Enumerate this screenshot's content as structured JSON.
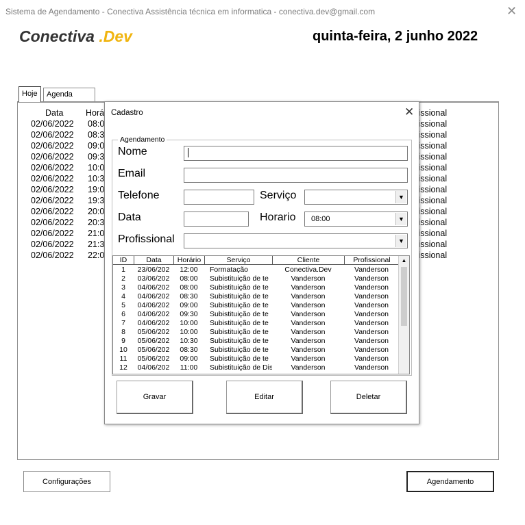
{
  "window": {
    "title": "Sistema de Agendamento - Conectiva Assistência técnica em informatica - conectiva.dev@gmail.com",
    "close_glyph": "✕"
  },
  "logo": {
    "part1": "Conectiva",
    "part2": " .Dev"
  },
  "date_heading": "quinta-feira, 2 junho 2022",
  "tabs": [
    {
      "label": "Hoje"
    },
    {
      "label": "Agenda"
    }
  ],
  "background_list": {
    "headers": {
      "data": "Data",
      "time": "Horá",
      "prof": "ofissional"
    },
    "rows": [
      {
        "date": "02/06/2022",
        "time": "08:0",
        "prof": "ofissional"
      },
      {
        "date": "02/06/2022",
        "time": "08:3",
        "prof": "ofissional"
      },
      {
        "date": "02/06/2022",
        "time": "09:0",
        "prof": "ofissional"
      },
      {
        "date": "02/06/2022",
        "time": "09:3",
        "prof": "ofissional"
      },
      {
        "date": "02/06/2022",
        "time": "10:0",
        "prof": "ofissional"
      },
      {
        "date": "02/06/2022",
        "time": "10:3",
        "prof": "ofissional"
      },
      {
        "date": "02/06/2022",
        "time": "19:0",
        "prof": "ofissional"
      },
      {
        "date": "02/06/2022",
        "time": "19:3",
        "prof": "ofissional"
      },
      {
        "date": "02/06/2022",
        "time": "20:0",
        "prof": "ofissional"
      },
      {
        "date": "02/06/2022",
        "time": "20:3",
        "prof": "ofissional"
      },
      {
        "date": "02/06/2022",
        "time": "21:0",
        "prof": "ofissional"
      },
      {
        "date": "02/06/2022",
        "time": "21:3",
        "prof": "ofissional"
      },
      {
        "date": "02/06/2022",
        "time": "22:0",
        "prof": "ofissional"
      }
    ]
  },
  "main_buttons": {
    "config": "Configurações",
    "agendamento": "Agendamento"
  },
  "dialog": {
    "title": "Cadastro",
    "close_glyph": "✕",
    "frame_label": "Agendamento",
    "labels": {
      "nome": "Nome",
      "email": "Email",
      "telefone": "Telefone",
      "servico": "Serviço",
      "data": "Data",
      "horario": "Horario",
      "profissional": "Profissional"
    },
    "fields": {
      "nome": "",
      "email": "",
      "telefone": "",
      "servico": "",
      "data": "",
      "horario": "08:00",
      "profissional": ""
    },
    "dropdown_glyph": "▼",
    "grid": {
      "headers": [
        "ID",
        "Data",
        "Horário",
        "Serviço",
        "Cliente",
        "Profissional"
      ],
      "rows": [
        [
          "1",
          "23/06/202",
          "12:00",
          "Formatação",
          "Conectiva.Dev",
          "Vanderson"
        ],
        [
          "2",
          "03/06/202",
          "08:00",
          "Subistituição de te",
          "Vanderson",
          "Vanderson"
        ],
        [
          "3",
          "04/06/202",
          "08:00",
          "Subistituição de te",
          "Vanderson",
          "Vanderson"
        ],
        [
          "4",
          "04/06/202",
          "08:30",
          "Subistituição de te",
          "Vanderson",
          "Vanderson"
        ],
        [
          "5",
          "04/06/202",
          "09:00",
          "Subistituição de te",
          "Vanderson",
          "Vanderson"
        ],
        [
          "6",
          "04/06/202",
          "09:30",
          "Subistituição de te",
          "Vanderson",
          "Vanderson"
        ],
        [
          "7",
          "04/06/202",
          "10:00",
          "Subistituição de te",
          "Vanderson",
          "Vanderson"
        ],
        [
          "8",
          "05/06/202",
          "10:00",
          "Subistituição de te",
          "Vanderson",
          "Vanderson"
        ],
        [
          "9",
          "05/06/202",
          "10:30",
          "Subistituição de te",
          "Vanderson",
          "Vanderson"
        ],
        [
          "10",
          "05/06/202",
          "08:30",
          "Subistituição de te",
          "Vanderson",
          "Vanderson"
        ],
        [
          "11",
          "05/06/202",
          "09:00",
          "Subistituição de te",
          "Vanderson",
          "Vanderson"
        ],
        [
          "12",
          "04/06/202",
          "11:00",
          "Subistituição de Dis",
          "Vanderson",
          "Vanderson"
        ]
      ],
      "scroll_up_glyph": "▲"
    },
    "buttons": {
      "gravar": "Gravar",
      "editar": "Editar",
      "deletar": "Deletar"
    }
  },
  "colors": {
    "brand_accent": "#f0b40f",
    "brand_text": "#333333"
  }
}
